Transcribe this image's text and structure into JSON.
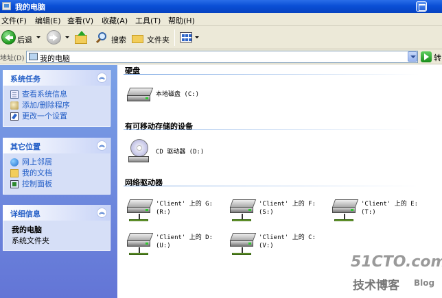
{
  "window": {
    "title": "我的电脑"
  },
  "menu": [
    {
      "label": "文件(F)"
    },
    {
      "label": "编辑(E)"
    },
    {
      "label": "查看(V)"
    },
    {
      "label": "收藏(A)"
    },
    {
      "label": "工具(T)"
    },
    {
      "label": "帮助(H)"
    }
  ],
  "toolbar": {
    "back_label": "后退",
    "search_label": "搜索",
    "folders_label": "文件夹"
  },
  "address": {
    "label": "地址(D)",
    "value": "我的电脑",
    "go_label": "转"
  },
  "sidebar": {
    "system_tasks": {
      "title": "系统任务",
      "items": [
        {
          "label": "查看系统信息",
          "icon": "system-info-icon"
        },
        {
          "label": "添加/删除程序",
          "icon": "add-remove-icon"
        },
        {
          "label": "更改一个设置",
          "icon": "control-settings-icon"
        }
      ]
    },
    "other_places": {
      "title": "其它位置",
      "items": [
        {
          "label": "网上邻居",
          "icon": "network-places-icon"
        },
        {
          "label": "我的文档",
          "icon": "my-documents-icon"
        },
        {
          "label": "控制面板",
          "icon": "control-panel-icon"
        }
      ]
    },
    "details": {
      "title": "详细信息",
      "name": "我的电脑",
      "type": "系统文件夹"
    }
  },
  "content": {
    "hard_disks": {
      "title": "硬盘",
      "items": [
        {
          "label": "本地磁盘 (C:)"
        }
      ]
    },
    "removable": {
      "title": "有可移动存储的设备",
      "items": [
        {
          "label": "CD 驱动器 (D:)"
        }
      ]
    },
    "network": {
      "title": "网络驱动器",
      "items": [
        {
          "line1": "'Client' 上的 G:",
          "line2": "(R:)"
        },
        {
          "line1": "'Client' 上的 F:",
          "line2": "(S:)"
        },
        {
          "line1": "'Client' 上的 E:",
          "line2": "(T:)"
        },
        {
          "line1": "'Client' 上的 D:",
          "line2": "(U:)"
        },
        {
          "line1": "'Client' 上的 C:",
          "line2": "(V:)"
        }
      ]
    }
  },
  "watermark": {
    "line1": "51CTO.com",
    "line2": "技术博客",
    "line3": "Blog"
  }
}
